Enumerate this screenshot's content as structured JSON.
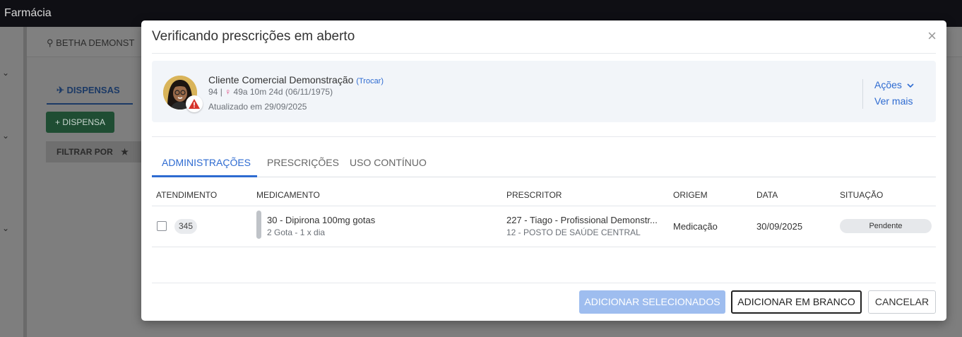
{
  "app": {
    "title": "Farmácia"
  },
  "background": {
    "breadcrumb": "BETHA DEMONST",
    "tab_label": "DISPENSAS",
    "new_button": "DISPENSA",
    "filter_label": "FILTRAR POR"
  },
  "modal": {
    "title": "Verificando prescrições em aberto",
    "close_glyph": "×",
    "patient": {
      "name": "Cliente Comercial Demonstração",
      "change_link": "(Trocar)",
      "code": "94",
      "separator": "|",
      "age": "49a 10m 24d (06/11/1975)",
      "updated": "Atualizado em 29/09/2025",
      "actions_label": "Ações",
      "see_more_label": "Ver mais",
      "alert_icon": "warning-icon"
    },
    "tabs": [
      {
        "label": "ADMINISTRAÇÕES",
        "active": true
      },
      {
        "label": "PRESCRIÇÕES",
        "active": false
      },
      {
        "label": "USO CONTÍNUO",
        "active": false
      }
    ],
    "table": {
      "columns": [
        "ATENDIMENTO",
        "MEDICAMENTO",
        "PRESCRITOR",
        "ORIGEM",
        "DATA",
        "SITUAÇÃO"
      ],
      "rows": [
        {
          "atendimento": "345",
          "medicamento": "30 - Dipirona 100mg gotas",
          "posologia": "2 Gota - 1 x dia",
          "prescritor": "227 - Tiago - Profissional Demonstr...",
          "unidade": "12 - POSTO DE SAÚDE CENTRAL",
          "origem": "Medicação",
          "data": "30/09/2025",
          "situacao": "Pendente"
        }
      ]
    },
    "buttons": {
      "add_selected": "ADICIONAR SELECIONADOS",
      "add_blank": "ADICIONAR EM BRANCO",
      "cancel": "CANCELAR"
    }
  },
  "colors": {
    "accent": "#2e6bd1",
    "primary_button": "#9ebdef",
    "warning": "#d6332b",
    "dispense_button": "#1f4d33"
  }
}
